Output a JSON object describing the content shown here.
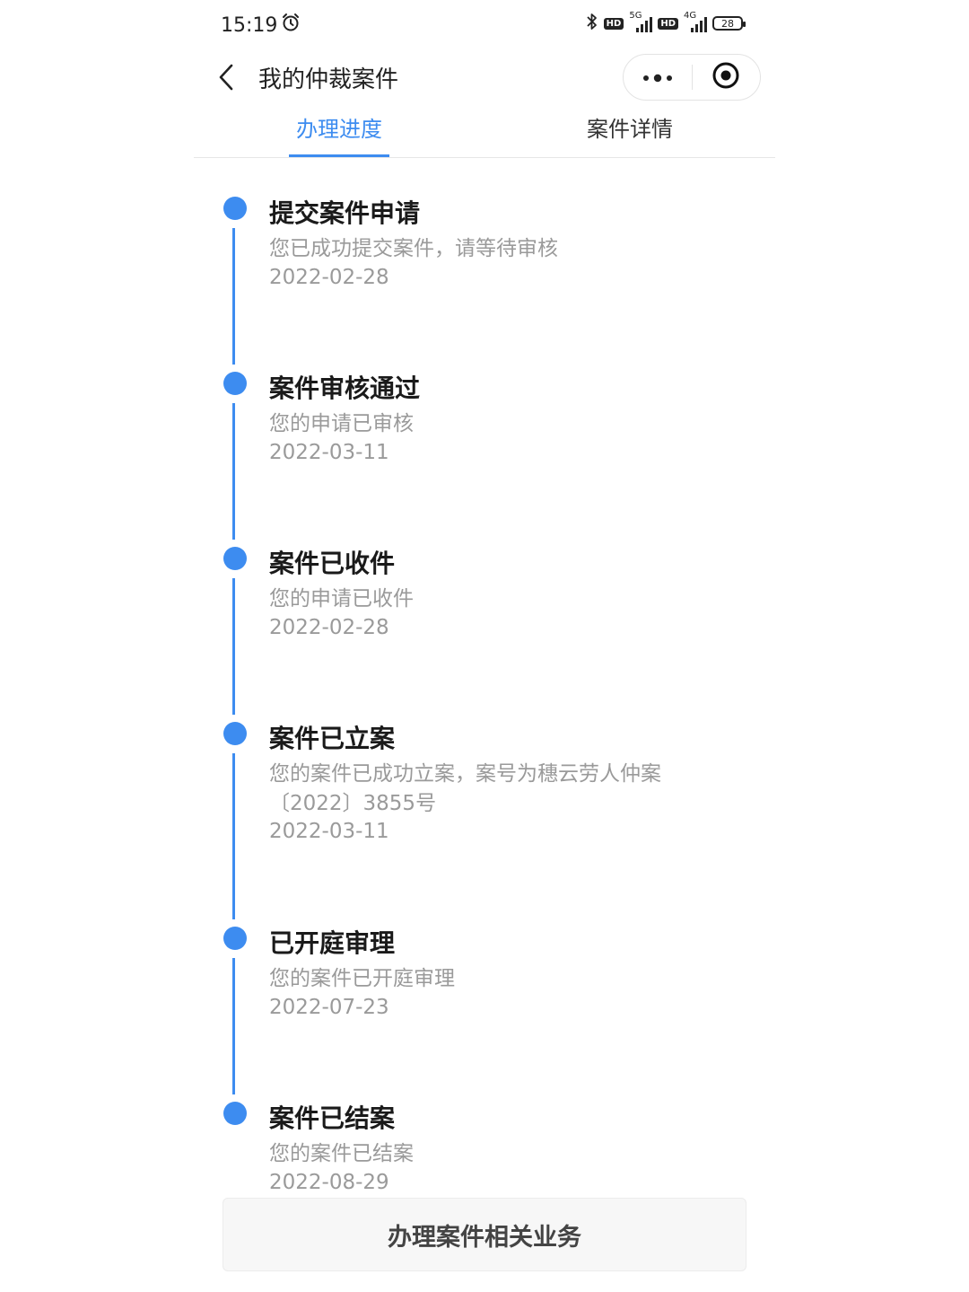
{
  "status_bar": {
    "time": "15:19",
    "network_1": "5G",
    "network_2": "4G",
    "hd": "HD",
    "battery": "28"
  },
  "nav": {
    "title": "我的仲裁案件"
  },
  "tabs": [
    {
      "label": "办理进度",
      "active": true
    },
    {
      "label": "案件详情",
      "active": false
    }
  ],
  "timeline": [
    {
      "title": "提交案件申请",
      "desc_lines": [
        "您已成功提交案件，请等待审核"
      ],
      "date": "2022-02-28"
    },
    {
      "title": "案件审核通过",
      "desc_lines": [
        "您的申请已审核"
      ],
      "date": "2022-03-11"
    },
    {
      "title": "案件已收件",
      "desc_lines": [
        "您的申请已收件"
      ],
      "date": "2022-02-28"
    },
    {
      "title": "案件已立案",
      "desc_lines": [
        "您的案件已成功立案，案号为穗云劳人仲案",
        "〔2022〕3855号"
      ],
      "date": "2022-03-11"
    },
    {
      "title": "已开庭审理",
      "desc_lines": [
        "您的案件已开庭审理"
      ],
      "date": "2022-07-23"
    },
    {
      "title": "案件已结案",
      "desc_lines": [
        "您的案件已结案"
      ],
      "date": "2022-08-29"
    }
  ],
  "action_button": {
    "label": "办理案件相关业务"
  },
  "colors": {
    "accent": "#3d8cf0",
    "muted_text": "#9a9a9a"
  }
}
